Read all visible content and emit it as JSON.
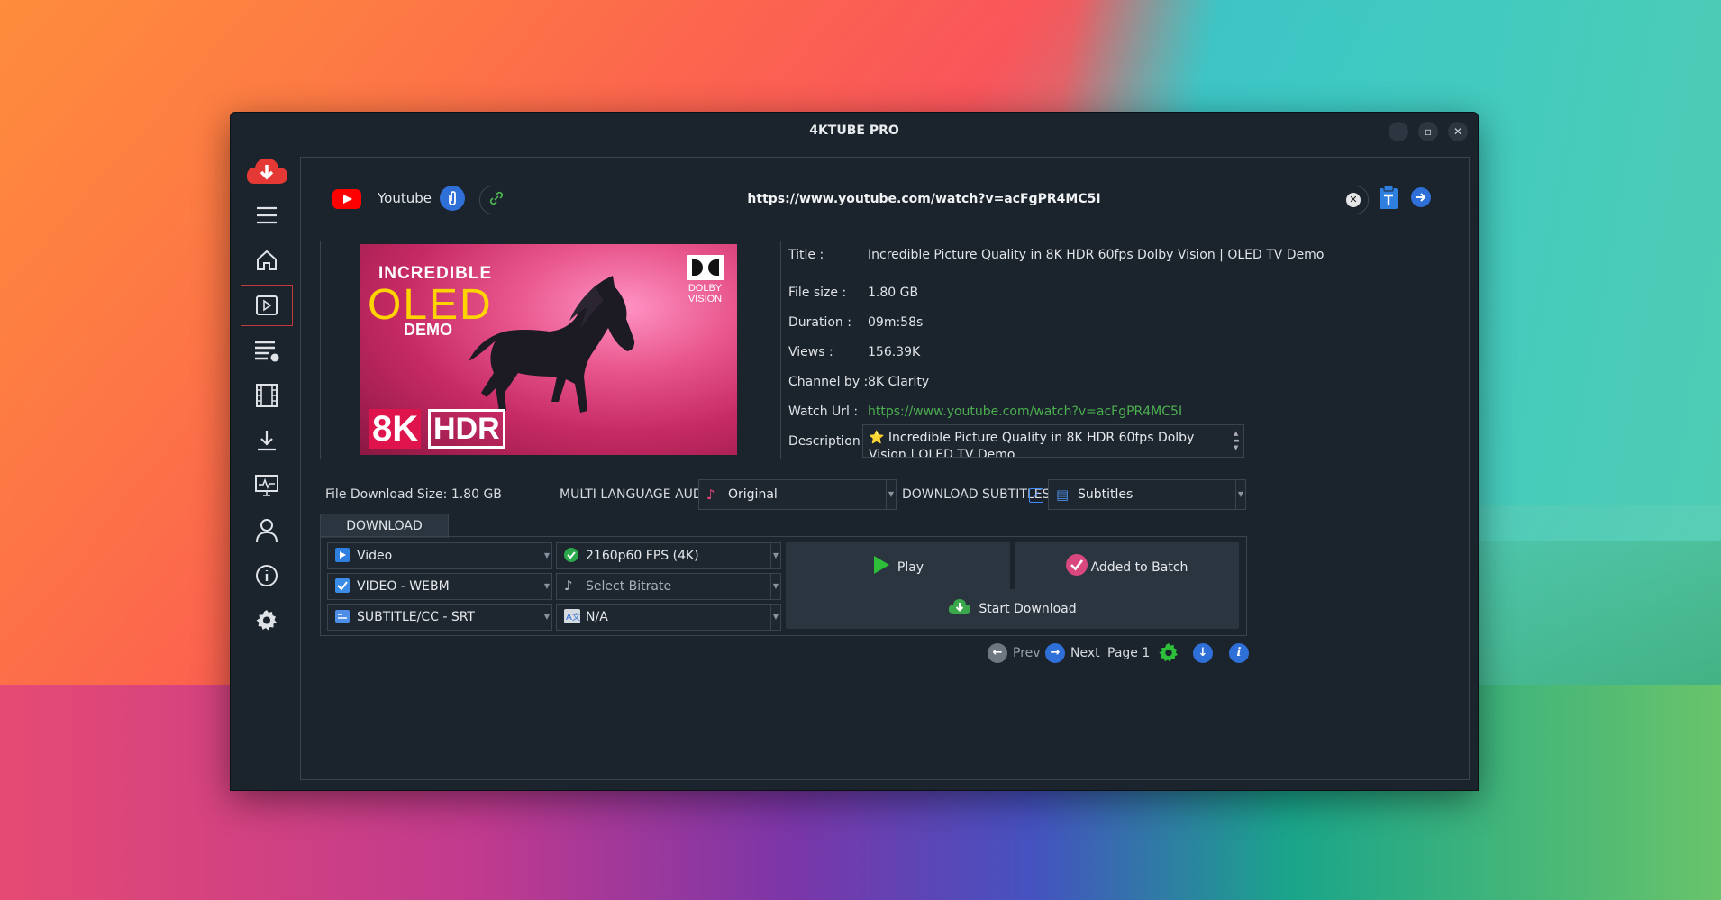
{
  "window": {
    "title": "4KTUBE PRO",
    "controls": [
      "–",
      "▫",
      "✕"
    ]
  },
  "sidebar": {
    "items": [
      {
        "name": "cloud-download",
        "glyph": "⬇"
      },
      {
        "name": "menu",
        "glyph": "☰"
      },
      {
        "name": "home",
        "glyph": "⌂"
      },
      {
        "name": "player",
        "glyph": "▷"
      },
      {
        "name": "playlist",
        "glyph": "≡"
      },
      {
        "name": "film",
        "glyph": "🎞"
      },
      {
        "name": "downloads",
        "glyph": "⤓"
      },
      {
        "name": "monitor",
        "glyph": "🖵"
      },
      {
        "name": "user",
        "glyph": "◯"
      },
      {
        "name": "info",
        "glyph": "ⓘ"
      },
      {
        "name": "settings",
        "glyph": "⚙"
      }
    ]
  },
  "url_bar": {
    "source": "Youtube",
    "url": "https://www.youtube.com/watch?v=acFgPR4MC5I"
  },
  "thumbnail": {
    "line1": "INCREDIBLE",
    "line2": "OLED",
    "line3": "DEMO",
    "badge1": "8K",
    "badge2": "HDR",
    "brand_top": "DOLBY",
    "brand_bottom": "VISION"
  },
  "info": {
    "title_label": "Title :",
    "title_value": "Incredible Picture Quality in 8K HDR 60fps Dolby Vision | OLED TV Demo",
    "size_label": "File size :",
    "size_value": "1.80 GB",
    "duration_label": "Duration :",
    "duration_value": "09m:58s",
    "views_label": "Views :",
    "views_value": "156.39K",
    "channel_label": "Channel by :",
    "channel_value": "8K Clarity",
    "watch_label": "Watch Url :",
    "watch_value": "https://www.youtube.com/watch?v=acFgPR4MC5I",
    "desc_label": "Description :",
    "desc_value": "⭐ Incredible Picture Quality in 8K HDR 60fps Dolby Vision | OLED TV Demo"
  },
  "options_bar": {
    "download_size": "File Download Size: 1.80 GB",
    "multi_audio_label": "MULTI LANGUAGE AUDIO",
    "audio_value": "Original",
    "subtitles_label": "DOWNLOAD SUBTITLES",
    "subtitles_value": "Subtitles"
  },
  "download_options": {
    "tab": "DOWNLOAD OPTIONS",
    "type": "Video",
    "format": "VIDEO - WEBM",
    "subtitle": "SUBTITLE/CC - SRT",
    "quality": "2160p60 FPS (4K)",
    "bitrate_placeholder": "Select Bitrate",
    "language": "N/A",
    "play": "Play",
    "batch": "Added to Batch",
    "start": "Start Download"
  },
  "footer": {
    "prev": "Prev",
    "next": "Next",
    "page": "Page 1"
  },
  "colors": {
    "accent_blue": "#2f6fd8",
    "accent_green": "#4caf50",
    "youtube_red": "#ff0000",
    "batch_pink": "#e0457b"
  }
}
